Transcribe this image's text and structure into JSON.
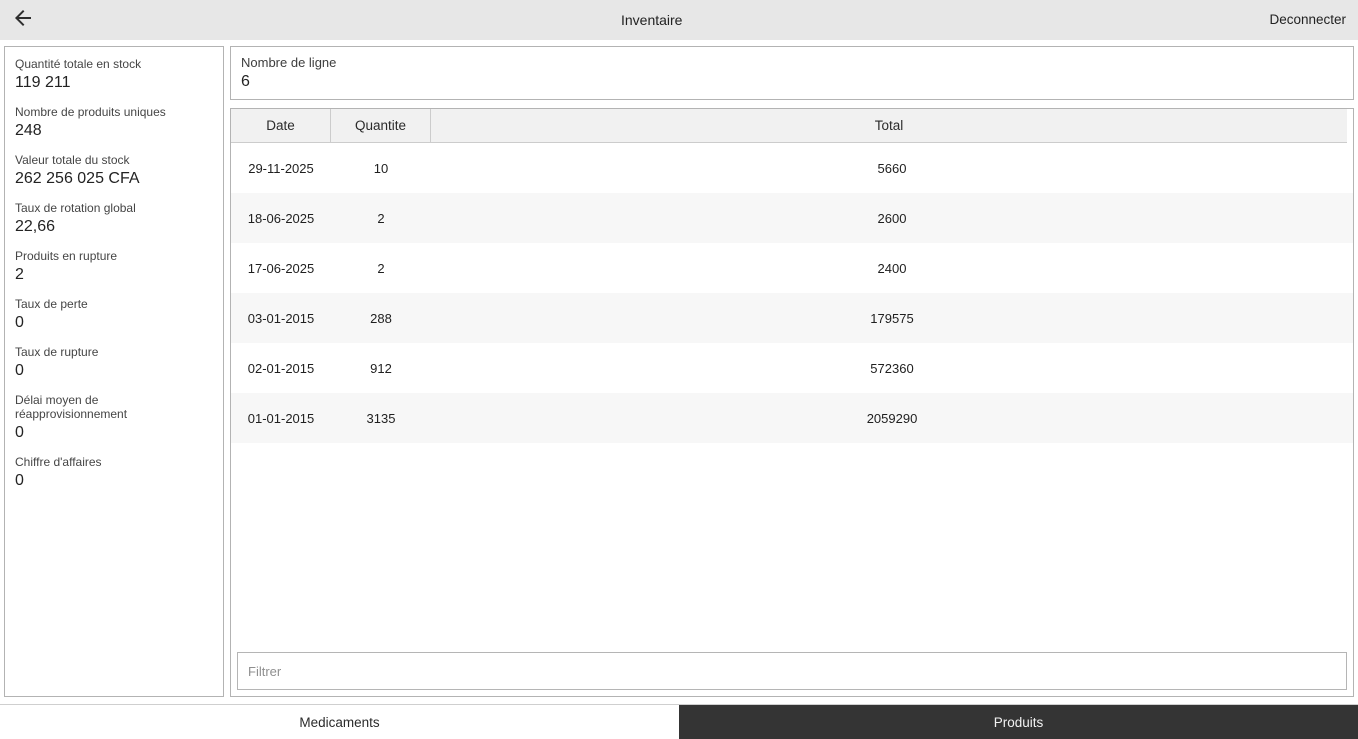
{
  "appbar": {
    "title": "Inventaire",
    "logout_label": "Deconnecter"
  },
  "sidebar": {
    "stats": [
      {
        "label": "Quantité totale en stock",
        "value": "119 211"
      },
      {
        "label": "Nombre de produits uniques",
        "value": "248"
      },
      {
        "label": "Valeur totale du stock",
        "value": "262 256 025 CFA"
      },
      {
        "label": "Taux de rotation global",
        "value": "22,66"
      },
      {
        "label": "Produits en rupture",
        "value": "2"
      },
      {
        "label": "Taux de perte",
        "value": "0"
      },
      {
        "label": "Taux de rupture",
        "value": "0"
      },
      {
        "label": "Délai moyen de réapprovisionnement",
        "value": "0"
      },
      {
        "label": "Chiffre d'affaires",
        "value": "0"
      }
    ]
  },
  "main": {
    "line_count": {
      "label": "Nombre de ligne",
      "value": "6"
    },
    "table": {
      "columns": [
        "Date",
        "Quantite",
        "Total"
      ],
      "rows": [
        {
          "date": "29-11-2025",
          "quantity": "10",
          "total": "5660"
        },
        {
          "date": "18-06-2025",
          "quantity": "2",
          "total": "2600"
        },
        {
          "date": "17-06-2025",
          "quantity": "2",
          "total": "2400"
        },
        {
          "date": "03-01-2015",
          "quantity": "288",
          "total": "179575"
        },
        {
          "date": "02-01-2015",
          "quantity": "912",
          "total": "572360"
        },
        {
          "date": "01-01-2015",
          "quantity": "3135",
          "total": "2059290"
        }
      ]
    },
    "filter": {
      "placeholder": "Filtrer"
    }
  },
  "tabs": [
    {
      "label": "Medicaments",
      "active": false
    },
    {
      "label": "Produits",
      "active": true
    }
  ],
  "colors": {
    "appbar_bg": "#e7e7e7",
    "panel_border": "#b3b3b3",
    "table_header_bg": "#f1f1f1",
    "row_alt_bg": "#f7f7f7",
    "tab_active_bg": "#343434",
    "tab_active_text": "#f2f2f2"
  }
}
